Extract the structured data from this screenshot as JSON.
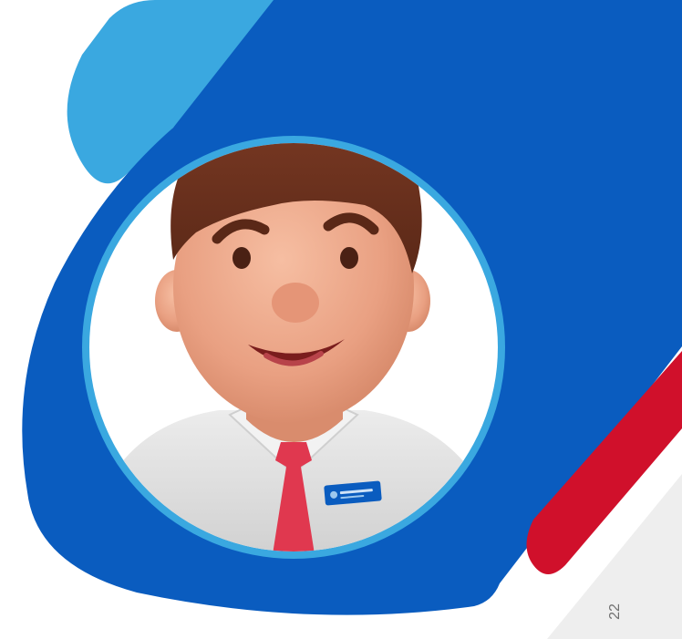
{
  "page": {
    "page_number": "22"
  },
  "mascot": {
    "icon": "mascot-avatar-icon",
    "badge_logo": "name-badge-logo"
  },
  "colors": {
    "primary_blue": "#0a5cbf",
    "light_blue": "#3aa8e0",
    "red": "#d0102b",
    "light_gray": "#eeeeee",
    "hair": "#6e3320",
    "skin": "#eba789",
    "shirt": "#e4e4e4",
    "tie": "#e0384f"
  }
}
